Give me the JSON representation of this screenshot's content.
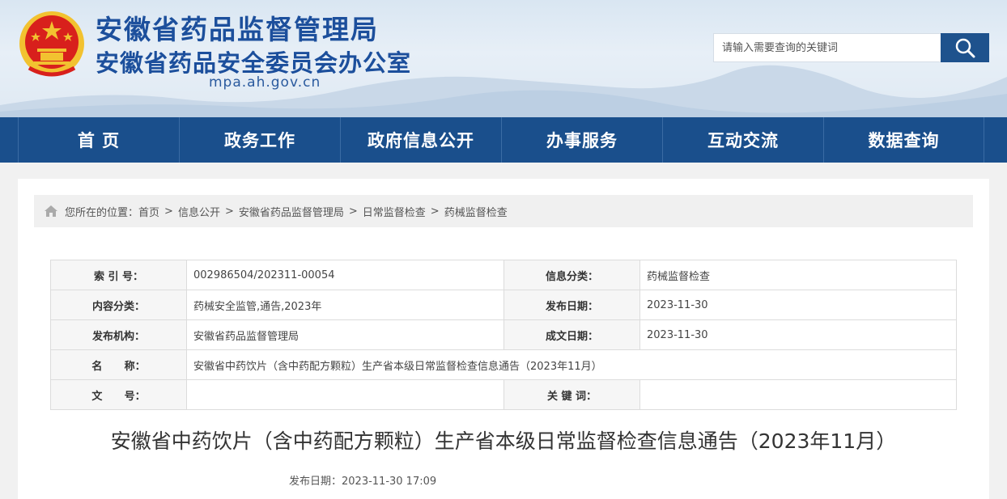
{
  "header": {
    "title_line1": "安徽省药品监督管理局",
    "title_line2": "安徽省药品安全委员会办公室",
    "domain": "mpa.ah.gov.cn",
    "search_placeholder": "请输入需要查询的关键词",
    "search_icon": "search-icon",
    "emblem_icon": "national-emblem-icon"
  },
  "nav": {
    "items": [
      "首  页",
      "政务工作",
      "政府信息公开",
      "办事服务",
      "互动交流",
      "数据查询"
    ]
  },
  "breadcrumb": {
    "prefix": "您所在的位置：",
    "items": [
      "首页",
      "信息公开",
      "安徽省药品监督管理局",
      "日常监督检查",
      "药械监督检查"
    ],
    "separator": ">"
  },
  "meta": {
    "index_label": "索 引 号：",
    "index_value": "002986504/202311-00054",
    "category_label": "信息分类：",
    "category_value": "药械监督检查",
    "content_label": "内容分类：",
    "content_value": "药械安全监管,通告,2023年",
    "pubdate_label": "发布日期：",
    "pubdate_value": "2023-11-30",
    "org_label": "发布机构：",
    "org_value": "安徽省药品监督管理局",
    "created_label": "成文日期：",
    "created_value": "2023-11-30",
    "name_label": "名      称：",
    "name_value": "安徽省中药饮片（含中药配方颗粒）生产省本级日常监督检查信息通告（2023年11月）",
    "docno_label": "文      号：",
    "docno_value": "",
    "keyword_label": "关 键 词：",
    "keyword_value": ""
  },
  "article": {
    "title": "安徽省中药饮片（含中药配方颗粒）生产省本级日常监督检查信息通告（2023年11月）",
    "pubdate": "发布日期：2023-11-30 17:09"
  },
  "colors": {
    "brand": "#1a4f8c",
    "title": "#1c4f9c",
    "emblem_red": "#d8201c",
    "emblem_gold": "#f2c230"
  }
}
